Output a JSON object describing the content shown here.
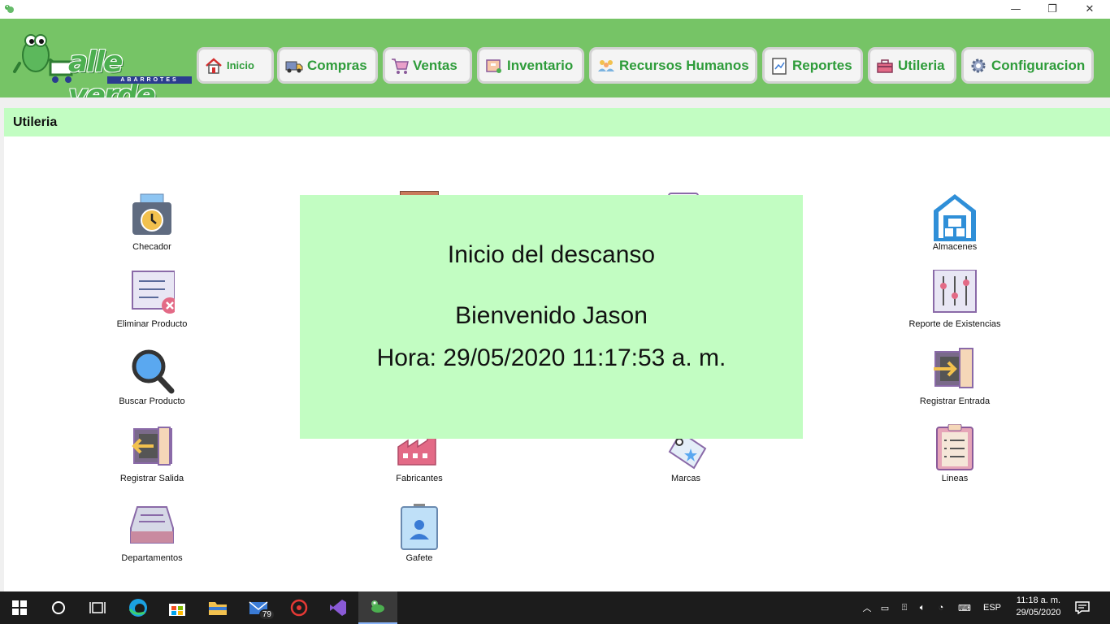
{
  "window": {
    "minimize": "—",
    "maximize": "❐",
    "close": "✕"
  },
  "logo": {
    "name": "alle verde",
    "tagline": "ABARROTES"
  },
  "nav": [
    {
      "label": "Inicio",
      "icon": "home-icon"
    },
    {
      "label": "Compras",
      "icon": "truck-icon"
    },
    {
      "label": "Ventas",
      "icon": "cart-icon"
    },
    {
      "label": "Inventario",
      "icon": "box-icon"
    },
    {
      "label": "Recursos Humanos",
      "icon": "people-icon"
    },
    {
      "label": "Reportes",
      "icon": "report-icon"
    },
    {
      "label": "Utileria",
      "icon": "toolbox-icon"
    },
    {
      "label": "Configuracion",
      "icon": "gear-icon"
    }
  ],
  "section": {
    "title": "Utileria"
  },
  "tiles": [
    {
      "label": "Checador",
      "icon": "time-clock-icon"
    },
    {
      "label": "Eliminar Producto",
      "icon": "delete-list-icon"
    },
    {
      "label": "Buscar Producto",
      "icon": "magnifier-icon"
    },
    {
      "label": "Registrar Salida",
      "icon": "exit-icon"
    },
    {
      "label": "Departamentos",
      "icon": "tray-icon"
    },
    {
      "label": "Fabricantes",
      "icon": "factory-icon"
    },
    {
      "label": "Gafete",
      "icon": "badge-icon"
    },
    {
      "label": "Marcas",
      "icon": "tag-icon"
    },
    {
      "label": "Almacenes",
      "icon": "warehouse-icon"
    },
    {
      "label": "Reporte de Existencias",
      "icon": "sliders-icon"
    },
    {
      "label": "Registrar Entrada",
      "icon": "enter-icon"
    },
    {
      "label": "Lineas",
      "icon": "clipboard-list-icon"
    }
  ],
  "overlay": {
    "line1": "Inicio del descanso",
    "line2": "Bienvenido Jason",
    "line3": "Hora: 29/05/2020 11:17:53 a. m."
  },
  "taskbar": {
    "mail_badge": "79",
    "language": "ESP",
    "time": "11:18 a. m.",
    "date": "29/05/2020"
  }
}
